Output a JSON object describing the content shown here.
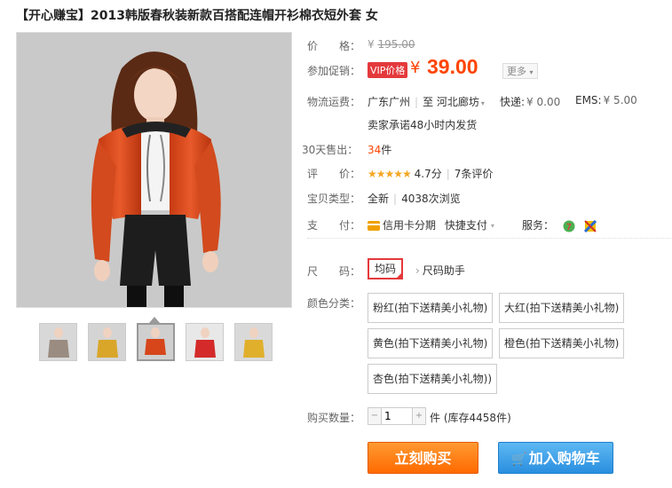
{
  "title": "【开心赚宝】2013韩版春秋装新款百搭配连帽开衫棉衣短外套 女",
  "price": {
    "label": "价　　格：",
    "currency": "¥",
    "original": "195.00"
  },
  "promo": {
    "label": "参加促销：",
    "vip_badge": "VIP价格",
    "currency": "¥",
    "price": "39.00",
    "more_label": "更多"
  },
  "shipping": {
    "label": "物流运费：",
    "from": "广东广州",
    "to_prefix": "至",
    "to": "河北廊坊",
    "express_label": "快递:",
    "express_price": "¥ 0.00",
    "ems_label": "EMS:",
    "ems_price": "¥ 5.00",
    "promise": "卖家承诺48小时内发货"
  },
  "sales": {
    "label": "30天售出：",
    "count": "34",
    "unit": "件"
  },
  "rating": {
    "label": "评　　价：",
    "stars": "★★★★★",
    "score": "4.7分",
    "reviews": "7条评价"
  },
  "item_type": {
    "label": "宝贝类型：",
    "condition": "全新",
    "views": "4038次浏览"
  },
  "payment": {
    "label": "支　　付：",
    "credit": "信用卡分期",
    "quick": "快捷支付",
    "service_label": "服务："
  },
  "size": {
    "label": "尺　　码：",
    "value": "均码",
    "helper": "尺码助手"
  },
  "colors": {
    "label": "颜色分类：",
    "options": [
      "粉红(拍下送精美小礼物)",
      "大红(拍下送精美小礼物)",
      "黄色(拍下送精美小礼物)",
      "橙色(拍下送精美小礼物)",
      "杏色(拍下送精美小礼物))"
    ]
  },
  "quantity": {
    "label": "购买数量：",
    "value": "1",
    "unit": "件",
    "stock": "(库存4458件)"
  },
  "buttons": {
    "buy_now": "立刻购买",
    "add_cart": "加入购物车"
  },
  "colors_theme": {
    "accent": "#ff4400",
    "buy": "#ff7a00",
    "cart": "#3399e6",
    "badge": "#e4393c"
  }
}
